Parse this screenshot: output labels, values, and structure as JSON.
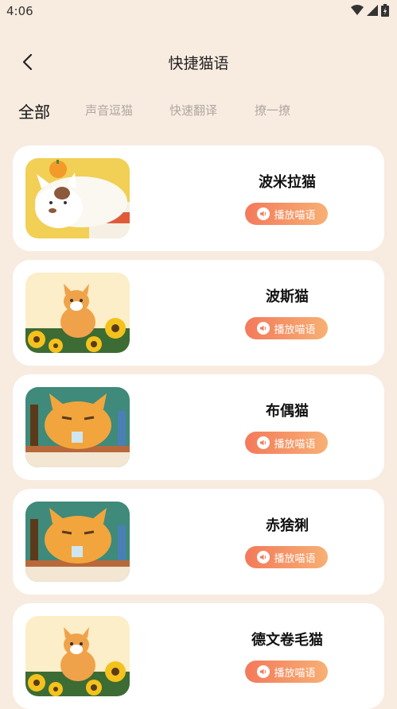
{
  "status_bar": {
    "time": "4:06",
    "icons": [
      "wifi-icon",
      "signal-icon",
      "battery-icon"
    ]
  },
  "header": {
    "title": "快捷猫语",
    "back_icon": "chevron-left-icon"
  },
  "tabs": [
    {
      "label": "全部",
      "active": true
    },
    {
      "label": "声音逗猫",
      "active": false
    },
    {
      "label": "快速翻译",
      "active": false
    },
    {
      "label": "撩一撩",
      "active": false
    }
  ],
  "colors": {
    "background": "#f8ebe0",
    "card": "#ffffff",
    "button_start": "#f37a5b",
    "button_end": "#f7b074"
  },
  "cards": [
    {
      "name": "波米拉猫",
      "button_label": "播放喵语",
      "image": "white-cat-illustration"
    },
    {
      "name": "波斯猫",
      "button_label": "播放喵语",
      "image": "orange-cat-sunflower-illustration"
    },
    {
      "name": "布偶猫",
      "button_label": "播放喵语",
      "image": "fat-orange-cat-bar-illustration"
    },
    {
      "name": "赤猞猁",
      "button_label": "播放喵语",
      "image": "fat-orange-cat-bar-illustration"
    },
    {
      "name": "德文卷毛猫",
      "button_label": "播放喵语",
      "image": "orange-cat-sunflower-illustration"
    }
  ]
}
